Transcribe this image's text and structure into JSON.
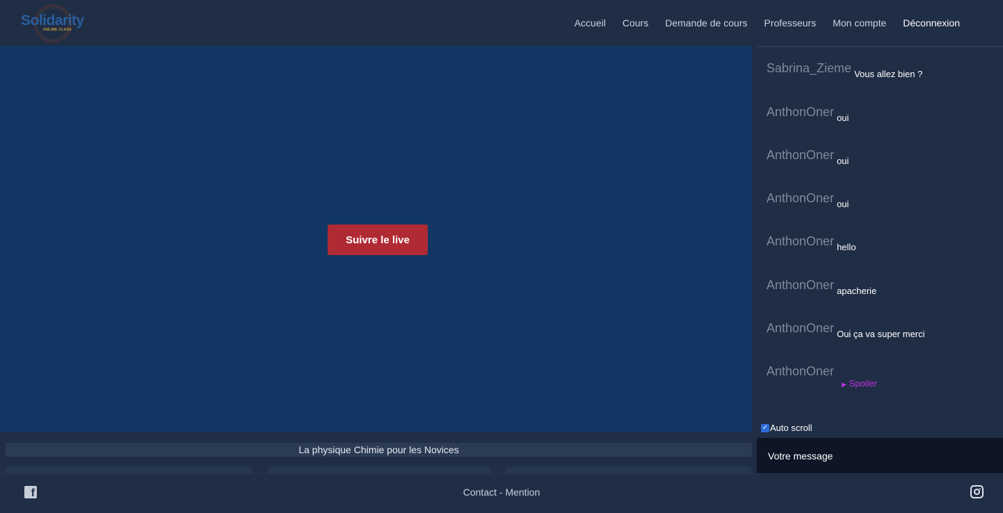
{
  "brand": {
    "name": "Solidarity",
    "tagline": "ONLINE CLASS"
  },
  "nav": {
    "items": [
      {
        "label": "Accueil"
      },
      {
        "label": "Cours"
      },
      {
        "label": "Demande de cours"
      },
      {
        "label": "Professeurs"
      },
      {
        "label": "Mon compte"
      },
      {
        "label": "Déconnexion"
      }
    ]
  },
  "video": {
    "button_label": "Suivre le live",
    "button_color": "#b02a34",
    "background": "#133764"
  },
  "course": {
    "title": "La physique Chimie pour les Novices"
  },
  "chat": {
    "messages": [
      {
        "user": "Sabrina_Zieme",
        "text": "Vous allez bien ?"
      },
      {
        "user": "AnthonOner",
        "text": "oui"
      },
      {
        "user": "AnthonOner",
        "text": "oui"
      },
      {
        "user": "AnthonOner",
        "text": "oui"
      },
      {
        "user": "AnthonOner",
        "text": "hello"
      },
      {
        "user": "AnthonOner",
        "text": "apacherie"
      },
      {
        "user": "AnthonOner",
        "text": "Oui ça va super merci"
      },
      {
        "user": "AnthonOner",
        "text": ""
      }
    ],
    "spoiler_label": "Spoiler",
    "autoscroll_label": "Auto scroll",
    "autoscroll_checked": true,
    "input_placeholder": "Votre message"
  },
  "footer": {
    "links": "Contact - Mention",
    "social": [
      "facebook-icon",
      "instagram-icon"
    ]
  }
}
